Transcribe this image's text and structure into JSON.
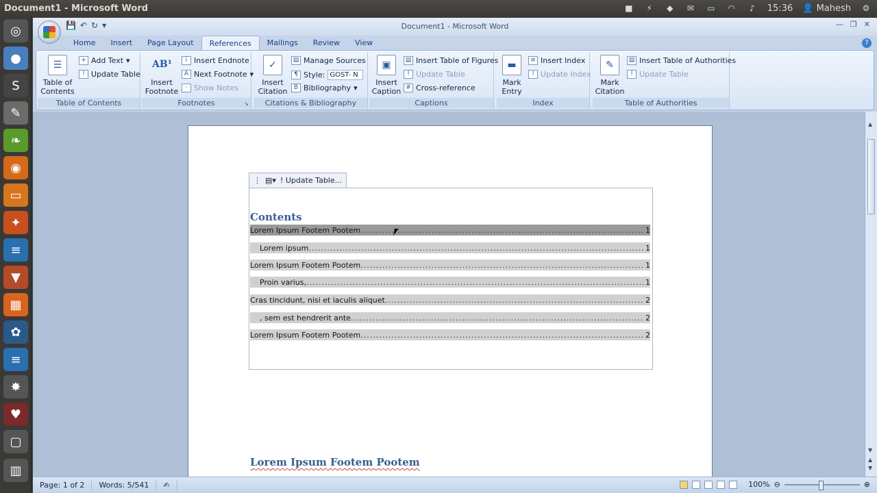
{
  "panel": {
    "title": "Document1 - Microsoft Word",
    "time": "15:36",
    "user": "Mahesh"
  },
  "launcher": {
    "icons": [
      "dash-icon",
      "chrome-icon",
      "sublime-icon",
      "text-editor-icon",
      "bitcoin-icon",
      "firefox-icon",
      "files-icon",
      "settings-icon",
      "writer-icon",
      "installer-icon",
      "impress-icon",
      "wine-icon",
      "document-icon",
      "colors-icon",
      "wine-glass-icon",
      "workspace-icon",
      "trash-icon"
    ]
  },
  "window": {
    "title": "Document1 - Microsoft Word"
  },
  "tabs": [
    "Home",
    "Insert",
    "Page Layout",
    "References",
    "Mailings",
    "Review",
    "View"
  ],
  "active_tab": "References",
  "ribbon": {
    "toc_group": {
      "label": "Table of Contents",
      "toc_button": "Table of Contents",
      "add_text": "Add Text",
      "update_table": "Update Table"
    },
    "footnotes_group": {
      "label": "Footnotes",
      "insert_footnote": "Insert Footnote",
      "insert_endnote": "Insert Endnote",
      "next_footnote": "Next Footnote",
      "show_notes": "Show Notes"
    },
    "citations_group": {
      "label": "Citations & Bibliography",
      "insert_citation": "Insert Citation",
      "manage_sources": "Manage Sources",
      "style_label": "Style:",
      "style_value": "GOST- N",
      "bibliography": "Bibliography"
    },
    "captions_group": {
      "label": "Captions",
      "insert_caption": "Insert Caption",
      "insert_tof": "Insert Table of Figures",
      "update_table": "Update Table",
      "cross_reference": "Cross-reference"
    },
    "index_group": {
      "label": "Index",
      "mark_entry": "Mark Entry",
      "insert_index": "Insert Index",
      "update_index": "Update Index"
    },
    "toa_group": {
      "label": "Table of Authorities",
      "mark_citation": "Mark Citation",
      "insert_toa": "Insert Table of Authorities",
      "update_table": "Update Table"
    }
  },
  "document": {
    "toc_tab_label": "Update Table...",
    "contents_heading": "Contents",
    "toc_entries": [
      {
        "text": "Lorem Ipsum Footem Pootem",
        "page": "1",
        "level": 1
      },
      {
        "text": "Lorem ipsum",
        "page": "1",
        "level": 2
      },
      {
        "text": "Lorem Ipsum Footem Pootem",
        "page": "1",
        "level": 1
      },
      {
        "text": "Proin varius,",
        "page": "1",
        "level": 2
      },
      {
        "text": "Cras tincidunt, nisi et iaculis aliquet",
        "page": "2",
        "level": 1
      },
      {
        "text": ", sem est hendrerit ante",
        "page": "2",
        "level": 2
      },
      {
        "text": "Lorem Ipsum Footem Pootem",
        "page": "2",
        "level": 1
      }
    ],
    "heading": "Lorem Ipsum Footem Pootem"
  },
  "statusbar": {
    "page": "Page: 1 of 2",
    "words": "Words: 5/541",
    "zoom": "100%"
  }
}
